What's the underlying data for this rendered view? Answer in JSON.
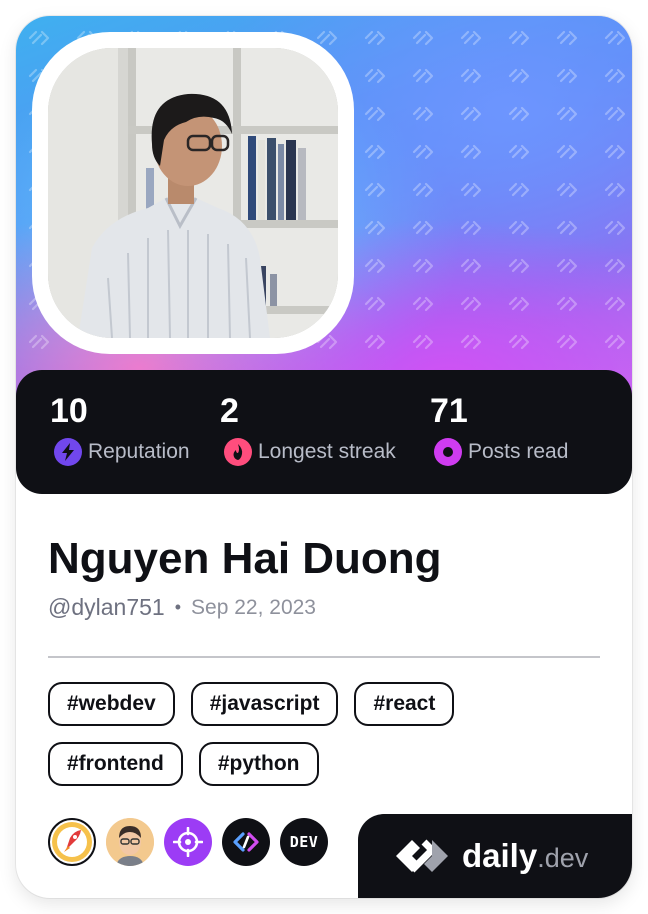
{
  "stats": [
    {
      "value": "10",
      "label": "Reputation",
      "icon": "bolt-icon",
      "color": "#7147ed"
    },
    {
      "value": "2",
      "label": "Longest streak",
      "icon": "flame-icon",
      "color": "#ff4d7d"
    },
    {
      "value": "71",
      "label": "Posts read",
      "icon": "eye-ring-icon",
      "color": "#cf3cf0"
    }
  ],
  "profile": {
    "name": "Nguyen Hai Duong",
    "handle": "@dylan751",
    "separator": "•",
    "joined": "Sep 22, 2023"
  },
  "tags": [
    "#webdev",
    "#javascript",
    "#react",
    "#frontend",
    "#python"
  ],
  "sources": [
    {
      "icon": "rocket-logo-icon"
    },
    {
      "icon": "memoji-avatar-icon"
    },
    {
      "icon": "crosshair-logo-icon"
    },
    {
      "icon": "link-logo-icon"
    },
    {
      "icon": "dev-logo-icon",
      "text": "DEV"
    }
  ],
  "brand": {
    "name": "daily",
    "tld": ".dev"
  },
  "colors": {
    "card_dark": "#0f1015",
    "tag_border": "#0f1015",
    "muted_text": "#6e7180"
  }
}
